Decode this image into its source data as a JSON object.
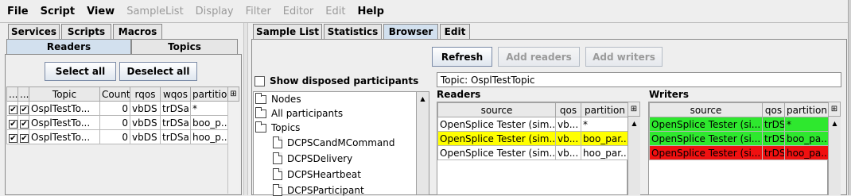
{
  "menu": [
    {
      "label": "File",
      "disabled": false
    },
    {
      "label": "Script",
      "disabled": false
    },
    {
      "label": "View",
      "disabled": false
    },
    {
      "label": "SampleList",
      "disabled": true
    },
    {
      "label": "Display",
      "disabled": true
    },
    {
      "label": "Filter",
      "disabled": true
    },
    {
      "label": "Editor",
      "disabled": true
    },
    {
      "label": "Edit",
      "disabled": true
    },
    {
      "label": "Help",
      "disabled": false
    }
  ],
  "left": {
    "tabs_top": [
      "Services",
      "Scripts",
      "Macros"
    ],
    "tabs_sub": [
      "Readers",
      "Topics"
    ],
    "select_all": "Select all",
    "deselect_all": "Deselect all",
    "columns": [
      "...",
      "...",
      "Topic",
      "Count",
      "rqos",
      "wqos",
      "partition"
    ],
    "rows": [
      {
        "topic": "OsplTestTo...",
        "count": "0",
        "rqos": "vbDS",
        "wqos": "trDSa",
        "partition": "*"
      },
      {
        "topic": "OsplTestTo...",
        "count": "0",
        "rqos": "vbDS",
        "wqos": "trDSa",
        "partition": "boo_p..."
      },
      {
        "topic": "OsplTestTo...",
        "count": "0",
        "rqos": "vbDS",
        "wqos": "trDSa",
        "partition": "hoo_p..."
      }
    ]
  },
  "right": {
    "tabs": [
      "Sample List",
      "Statistics",
      "Browser",
      "Edit"
    ],
    "refresh": "Refresh",
    "add_readers": "Add readers",
    "add_writers": "Add writers",
    "show_disposed": "Show disposed participants",
    "topic_label": "Topic: OsplTestTopic",
    "tree": [
      {
        "label": "Nodes",
        "type": "folder"
      },
      {
        "label": "All participants",
        "type": "folder"
      },
      {
        "label": "Topics",
        "type": "folder"
      },
      {
        "label": "DCPSCandMCommand",
        "type": "doc"
      },
      {
        "label": "DCPSDelivery",
        "type": "doc"
      },
      {
        "label": "DCPSHeartbeat",
        "type": "doc"
      },
      {
        "label": "DCPSParticipant",
        "type": "doc"
      }
    ],
    "readers": {
      "title": "Readers",
      "columns": [
        "source",
        "qos",
        "partition"
      ],
      "rows": [
        {
          "source": "OpenSplice Tester (sim...",
          "qos": "vb...",
          "partition": "*"
        },
        {
          "source": "OpenSplice Tester (sim...",
          "qos": "vb...",
          "partition": "boo_par..."
        },
        {
          "source": "OpenSplice Tester (sim...",
          "qos": "vb...",
          "partition": "hoo_par..."
        }
      ]
    },
    "writers": {
      "title": "Writers",
      "columns": [
        "source",
        "qos",
        "partition"
      ],
      "rows": [
        {
          "source": "OpenSplice Tester (si...",
          "qos": "trDS",
          "partition": "*"
        },
        {
          "source": "OpenSplice Tester (si...",
          "qos": "trDS",
          "partition": "boo_pa..."
        },
        {
          "source": "OpenSplice Tester (si...",
          "qos": "trDS",
          "partition": "hoo_pa..."
        }
      ]
    }
  },
  "colors": {
    "yellow": "#ffff00",
    "green": "#2ee82e",
    "red": "#f01010",
    "tab_selected": "#d2e0ee"
  },
  "icons": {
    "check": "check-icon",
    "folder": "folder-icon",
    "doc": "document-icon",
    "column_picker": "column-picker-icon"
  }
}
